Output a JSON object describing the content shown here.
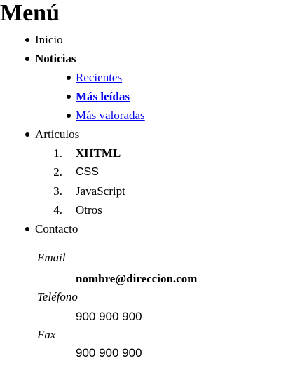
{
  "page": {
    "title": "Menú"
  },
  "menu": {
    "items": [
      {
        "label": "Inicio"
      },
      {
        "label": "Noticias",
        "children": [
          {
            "label": "Recientes"
          },
          {
            "label": "Más leídas"
          },
          {
            "label": "Más valoradas"
          }
        ]
      },
      {
        "label": "Artículos",
        "children": [
          {
            "number": "1.",
            "label": "XHTML"
          },
          {
            "number": "2.",
            "label": "CSS"
          },
          {
            "number": "3.",
            "label": "JavaScript"
          },
          {
            "number": "4.",
            "label": "Otros"
          }
        ]
      },
      {
        "label": "Contacto"
      }
    ]
  },
  "contact": {
    "email_term": "Email",
    "email_value": "nombre@direccion.com",
    "phone_term": "Teléfono",
    "phone_value": "900 900 900",
    "fax_term": "Fax",
    "fax_value": "900 900 900"
  },
  "colors": {
    "link": "#0000ee",
    "text": "#000000",
    "background": "#ffffff"
  }
}
